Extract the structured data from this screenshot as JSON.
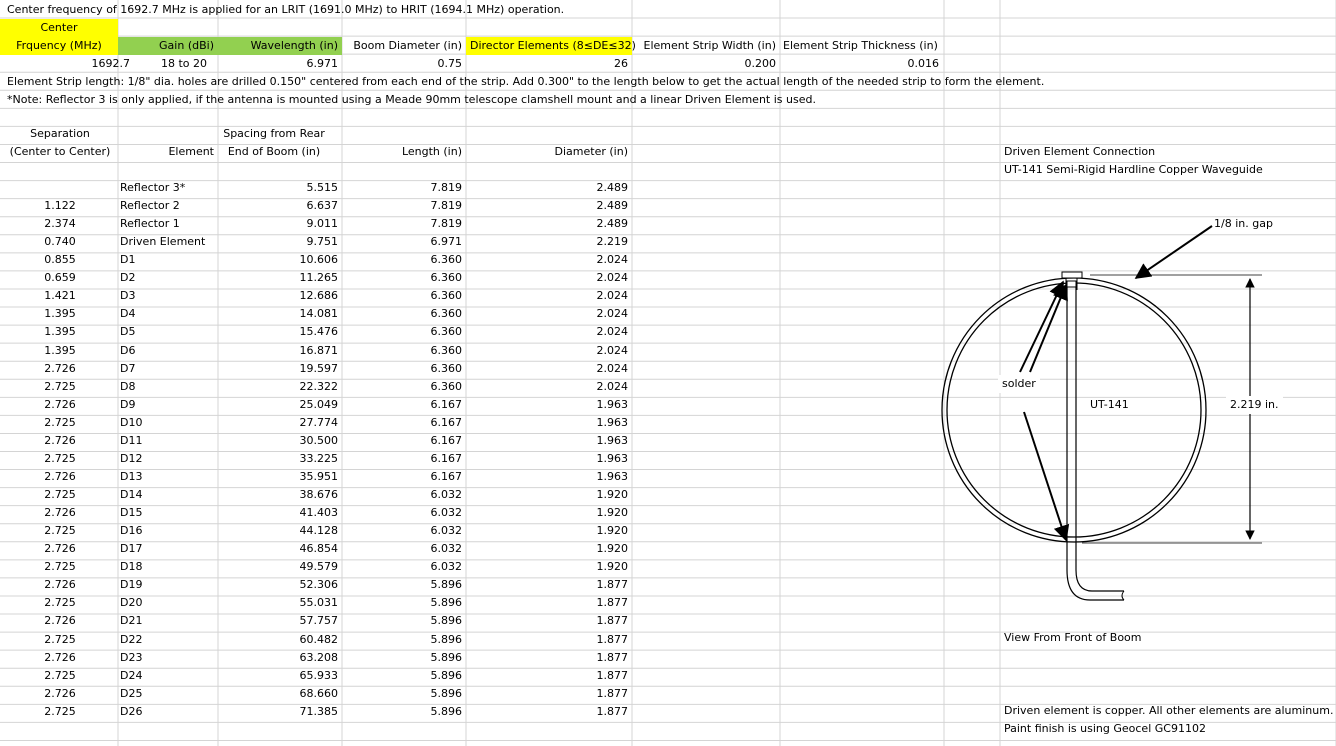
{
  "line1": "Center frequency of 1692.7 MHz is applied for an LRIT (1691.0 MHz) to HRIT (1694.1 MHz) operation.",
  "params": {
    "h_center_top": "Center",
    "h_center_bottom": "Frquency (MHz)",
    "h_gain": "Gain (dBi)",
    "h_wavelength": "Wavelength (in)",
    "h_boom": "Boom Diameter (in)",
    "h_directors": "Director Elements (8≤DE≤32)",
    "h_strip_width": "Element Strip Width (in)",
    "h_strip_thick": "Element Strip Thickness (in)",
    "v_center": "1692.7",
    "v_gain": "18 to 20",
    "v_wavelength": "6.971",
    "v_boom": "0.75",
    "v_directors": "26",
    "v_strip_width": "0.200",
    "v_strip_thick": "0.016"
  },
  "note1": "Element Strip length: 1/8\" dia. holes are drilled 0.150\" centered from each end of the strip. Add 0.300\" to the length below to get the actual length of the needed strip to form the element.",
  "note2": "*Note: Reflector 3 is only applied, if the antenna is mounted using a Meade 90mm telescope clamshell mount and a linear Driven Element is used.",
  "table_headers": {
    "sep_top": "Separation",
    "sep_bottom": "(Center to Center)",
    "element": "Element",
    "spacing_top": "Spacing from Rear",
    "spacing_bottom": "End of Boom (in)",
    "length": "Length (in)",
    "diameter": "Diameter (in)"
  },
  "rows": [
    {
      "sep": "",
      "el": "Reflector 3*",
      "spacing": "5.515",
      "len": "7.819",
      "dia": "2.489"
    },
    {
      "sep": "1.122",
      "el": "Reflector 2",
      "spacing": "6.637",
      "len": "7.819",
      "dia": "2.489"
    },
    {
      "sep": "2.374",
      "el": "Reflector 1",
      "spacing": "9.011",
      "len": "7.819",
      "dia": "2.489"
    },
    {
      "sep": "0.740",
      "el": "Driven Element",
      "spacing": "9.751",
      "len": "6.971",
      "dia": "2.219"
    },
    {
      "sep": "0.855",
      "el": "D1",
      "spacing": "10.606",
      "len": "6.360",
      "dia": "2.024"
    },
    {
      "sep": "0.659",
      "el": "D2",
      "spacing": "11.265",
      "len": "6.360",
      "dia": "2.024"
    },
    {
      "sep": "1.421",
      "el": "D3",
      "spacing": "12.686",
      "len": "6.360",
      "dia": "2.024"
    },
    {
      "sep": "1.395",
      "el": "D4",
      "spacing": "14.081",
      "len": "6.360",
      "dia": "2.024"
    },
    {
      "sep": "1.395",
      "el": "D5",
      "spacing": "15.476",
      "len": "6.360",
      "dia": "2.024"
    },
    {
      "sep": "1.395",
      "el": "D6",
      "spacing": "16.871",
      "len": "6.360",
      "dia": "2.024"
    },
    {
      "sep": "2.726",
      "el": "D7",
      "spacing": "19.597",
      "len": "6.360",
      "dia": "2.024"
    },
    {
      "sep": "2.725",
      "el": "D8",
      "spacing": "22.322",
      "len": "6.360",
      "dia": "2.024"
    },
    {
      "sep": "2.726",
      "el": "D9",
      "spacing": "25.049",
      "len": "6.167",
      "dia": "1.963"
    },
    {
      "sep": "2.725",
      "el": "D10",
      "spacing": "27.774",
      "len": "6.167",
      "dia": "1.963"
    },
    {
      "sep": "2.726",
      "el": "D11",
      "spacing": "30.500",
      "len": "6.167",
      "dia": "1.963"
    },
    {
      "sep": "2.725",
      "el": "D12",
      "spacing": "33.225",
      "len": "6.167",
      "dia": "1.963"
    },
    {
      "sep": "2.726",
      "el": "D13",
      "spacing": "35.951",
      "len": "6.167",
      "dia": "1.963"
    },
    {
      "sep": "2.725",
      "el": "D14",
      "spacing": "38.676",
      "len": "6.032",
      "dia": "1.920"
    },
    {
      "sep": "2.726",
      "el": "D15",
      "spacing": "41.403",
      "len": "6.032",
      "dia": "1.920"
    },
    {
      "sep": "2.725",
      "el": "D16",
      "spacing": "44.128",
      "len": "6.032",
      "dia": "1.920"
    },
    {
      "sep": "2.726",
      "el": "D17",
      "spacing": "46.854",
      "len": "6.032",
      "dia": "1.920"
    },
    {
      "sep": "2.725",
      "el": "D18",
      "spacing": "49.579",
      "len": "6.032",
      "dia": "1.920"
    },
    {
      "sep": "2.726",
      "el": "D19",
      "spacing": "52.306",
      "len": "5.896",
      "dia": "1.877"
    },
    {
      "sep": "2.725",
      "el": "D20",
      "spacing": "55.031",
      "len": "5.896",
      "dia": "1.877"
    },
    {
      "sep": "2.726",
      "el": "D21",
      "spacing": "57.757",
      "len": "5.896",
      "dia": "1.877"
    },
    {
      "sep": "2.725",
      "el": "D22",
      "spacing": "60.482",
      "len": "5.896",
      "dia": "1.877"
    },
    {
      "sep": "2.726",
      "el": "D23",
      "spacing": "63.208",
      "len": "5.896",
      "dia": "1.877"
    },
    {
      "sep": "2.725",
      "el": "D24",
      "spacing": "65.933",
      "len": "5.896",
      "dia": "1.877"
    },
    {
      "sep": "2.726",
      "el": "D25",
      "spacing": "68.660",
      "len": "5.896",
      "dia": "1.877"
    },
    {
      "sep": "2.725",
      "el": "D26",
      "spacing": "71.385",
      "len": "5.896",
      "dia": "1.877"
    }
  ],
  "diagram": {
    "title1": "Driven Element Connection",
    "title2": "UT-141 Semi-Rigid Hardline Copper Waveguide",
    "gap_label": "1/8 in. gap",
    "solder_label": "solder",
    "ut_label": "UT-141",
    "dim_label": "2.219  in.",
    "view_label": "View From Front of Boom",
    "footer1": "Driven element is copper. All other elements are aluminum.",
    "footer2": "Paint finish is using Geocel GC91102"
  },
  "colors": {
    "highlight_yellow": "#ffff00",
    "highlight_green": "#92d050",
    "gridline": "#d4d4d4"
  }
}
